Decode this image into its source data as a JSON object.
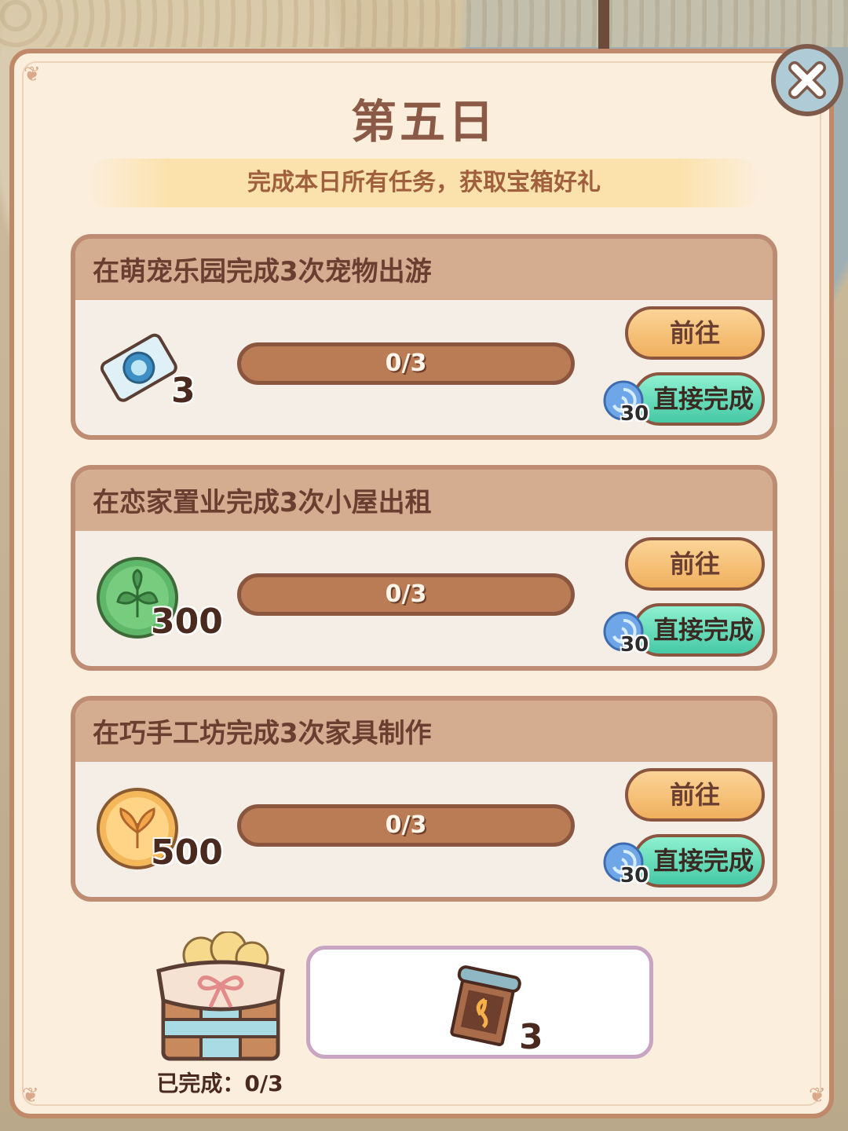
{
  "dialog": {
    "title": "第五日",
    "subtitle": "完成本日所有任务，获取宝箱好礼"
  },
  "tasks": [
    {
      "title": "在萌宠乐园完成3次宠物出游",
      "reward_icon": "pet-ticket-icon",
      "reward_qty": "3",
      "progress_text": "0/3",
      "progress_fraction": 0,
      "go_label": "前往",
      "complete_label": "直接完成",
      "gem_cost": "30"
    },
    {
      "title": "在恋家置业完成3次小屋出租",
      "reward_icon": "green-leaf-coin-icon",
      "reward_qty": "300",
      "progress_text": "0/3",
      "progress_fraction": 0,
      "go_label": "前往",
      "complete_label": "直接完成",
      "gem_cost": "30"
    },
    {
      "title": "在巧手工坊完成3次家具制作",
      "reward_icon": "gold-leaf-coin-icon",
      "reward_qty": "500",
      "progress_text": "0/3",
      "progress_fraction": 0,
      "go_label": "前往",
      "complete_label": "直接完成",
      "gem_cost": "30"
    }
  ],
  "chest": {
    "label": "已完成：0/3",
    "reward_icon": "blueprint-scroll-icon",
    "reward_qty": "3"
  },
  "colors": {
    "panel_bg": "#fbeedd",
    "panel_border": "#c08a6a",
    "go_button": "#f0b05e",
    "complete_button": "#46c9a6",
    "progress_track": "#b97c55"
  }
}
